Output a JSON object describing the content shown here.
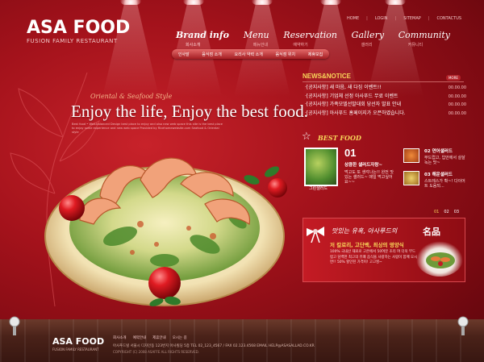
{
  "brand": {
    "name": "ASA FOOD",
    "tagline": "FUSION FAMILY RESTAURANT"
  },
  "util_nav": [
    "HOME",
    "LOGIN",
    "SITEMAP",
    "CONTACTUS"
  ],
  "main_nav": [
    {
      "label": "Brand info",
      "sub": "회사소개",
      "active": true
    },
    {
      "label": "Menu",
      "sub": "메뉴안내",
      "active": false
    },
    {
      "label": "Reservation",
      "sub": "예약하기",
      "active": false
    },
    {
      "label": "Gallery",
      "sub": "갤러리",
      "active": false
    },
    {
      "label": "Community",
      "sub": "커뮤니티",
      "active": false
    }
  ],
  "sub_nav": [
    "인사말",
    "음식점 소개",
    "요리사 약력 소개",
    "음식점 위치",
    "제휴모집"
  ],
  "hero": {
    "kicker": "Oriental & Seafood Style",
    "title": "Enjoy the life, Enjoy the best food.",
    "desc": "Best food • Well-balanced Design best place to enjoy and also new web space this site is the best place to enjoy some experience and new web space Provided by Ricehomewebsite.com Seafood & Oriental style"
  },
  "news": {
    "heading": "NEWS&NOTICE",
    "more": "MORE",
    "items": [
      {
        "title": "·[공지사항] 새 마음, 새 다짐 이벤트!!",
        "date": "00.00.00"
      },
      {
        "title": "·[공지사항] 기업체 선정 아사푸드 무료 이벤트",
        "date": "00.00.00"
      },
      {
        "title": "·[공지사항] 가족모델선발대회 당선자 발표 안내",
        "date": "00.00.00"
      },
      {
        "title": "·[공지사항] 아사푸드 홈페이지가 오픈하였습니다.",
        "date": "00.00.00"
      }
    ]
  },
  "best_food": {
    "heading": "BEST FOOD",
    "main_caption": "그린샐러드",
    "item1": {
      "num": "01",
      "title": "상큼한 샐러드자랑~",
      "desc": "먹고도 또 생각나는!! 완전 맛있는 샐러드~ 매일 먹고싶어요~~"
    },
    "item2": {
      "num": "02",
      "title": "연어샐러드",
      "desc": "부드럽고, 입안에서 살살 녹는 맛~"
    },
    "item3": {
      "num": "03",
      "title": "해운샐러드",
      "desc": "스트레스가 확~! 다이어트 도움되..."
    },
    "pager": [
      "01",
      "02",
      "03"
    ]
  },
  "banner": {
    "script": "맛있는 유혹, 아사푸드의",
    "emphasis": "名品",
    "title": "저 칼로리, 고단백, 최상의 영양식",
    "body": "100% 국내산 재료로 고온에서 50여분 조리 여 더욱 부드럽고 담백한 최고의 유쾌 음식을 사랑하는 사람이 함께 오시면!! 50% 할인된 가격이! 고고씽~"
  },
  "footer": {
    "logo": "ASA FOOD",
    "logo_sub": "FUSION FAMILY RESTAURANT",
    "links": [
      "회사소개",
      "예약안내",
      "제휴안내",
      "오시는 길"
    ],
    "address": "아사푸드빌 서울시 디자인동 123번지 아사빌딩 5층 TEL 02_123_4567 / FAX 02.123.4568   EMAIL HELP@ASASALLAD.CO.KR",
    "copyright": "COPYRIGHT (C) 2008 ASAFFE ALL RIGHTS RESERVED."
  },
  "colors": {
    "accent_yellow": "#f8d55a",
    "deep_red": "#7c0a12",
    "brand_red": "#c8222a"
  }
}
